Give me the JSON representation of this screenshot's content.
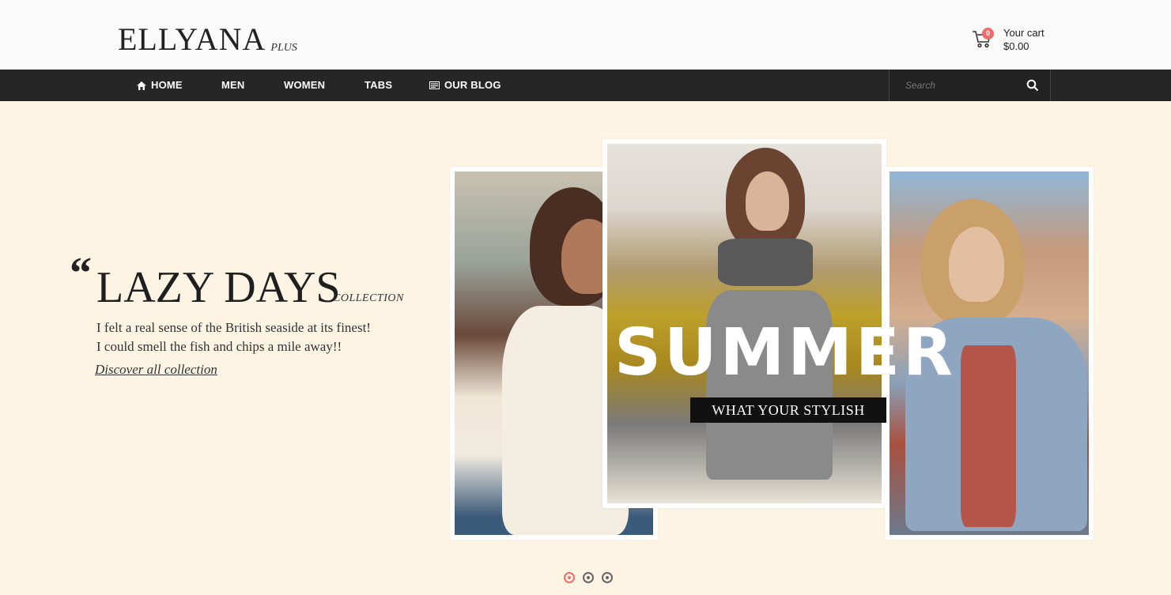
{
  "header": {
    "logo_main": "ELLYANA",
    "logo_sub": "PLUS",
    "cart": {
      "count": "0",
      "label": "Your cart",
      "total": "$0.00",
      "icon": "cart-icon",
      "badge_color": "#f26b6b"
    }
  },
  "nav": {
    "items": [
      {
        "label": "HOME",
        "icon": "home-icon"
      },
      {
        "label": "MEN"
      },
      {
        "label": "WOMEN"
      },
      {
        "label": "TABS"
      },
      {
        "label": "OUR BLOG",
        "icon": "blog-icon"
      }
    ],
    "search_placeholder": "Search",
    "search_icon": "search-icon"
  },
  "hero": {
    "quote_mark": "“",
    "headline": "LAZY DAYS",
    "collection": "COLLECTION",
    "desc_line1": "I felt a real sense of the British seaside at its finest!",
    "desc_line2": "I could smell the fish and chips a mile away!!",
    "discover": "Discover all collection",
    "banner_title": "SUMMER",
    "banner_subtitle": "WHAT YOUR STYLISH",
    "slides": {
      "count": 3,
      "active": 1
    }
  },
  "colors": {
    "accent": "#f26b6b",
    "nav_bg": "#262626",
    "hero_bg": "#fdf4e4"
  }
}
